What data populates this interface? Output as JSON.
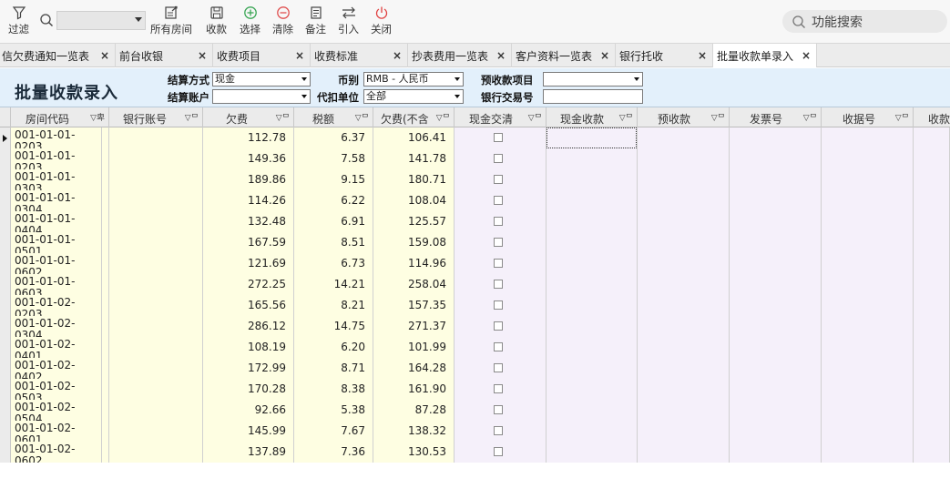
{
  "toolbar": {
    "filter_label": "过滤",
    "buttons": [
      {
        "label": "所有房间",
        "icon": "all-rooms-icon"
      },
      {
        "label": "收款",
        "icon": "save-icon"
      },
      {
        "label": "选择",
        "icon": "add-circle-icon"
      },
      {
        "label": "清除",
        "icon": "minus-circle-icon"
      },
      {
        "label": "备注",
        "icon": "note-icon"
      },
      {
        "label": "引入",
        "icon": "import-arrows-icon"
      },
      {
        "label": "关闭",
        "icon": "power-icon"
      }
    ],
    "function_search_placeholder": "功能搜索"
  },
  "tabs": [
    {
      "label": "信欠费通知一览表"
    },
    {
      "label": "前台收银"
    },
    {
      "label": "收费项目"
    },
    {
      "label": "收费标准"
    },
    {
      "label": "抄表费用一览表"
    },
    {
      "label": "客户资料一览表"
    },
    {
      "label": "银行托收"
    },
    {
      "label": "批量收款单录入",
      "active": true
    }
  ],
  "form": {
    "title": "批量收款录入",
    "settle_method_label": "结算方式",
    "settle_method_value": "现金",
    "settle_account_label": "结算账户",
    "settle_account_value": "",
    "currency_label": "币别",
    "currency_value": "RMB - 人民币",
    "agent_unit_label": "代扣单位",
    "agent_unit_value": "全部",
    "prepay_item_label": "预收款项目",
    "prepay_item_value": "",
    "bank_txn_label": "银行交易号",
    "bank_txn_value": ""
  },
  "grid": {
    "columns": [
      {
        "label": "房间代码",
        "filter": "▽卑"
      },
      {
        "label": "银行账号",
        "filter": "▽ᄆ"
      },
      {
        "label": "欠费",
        "filter": "▽ᄆ"
      },
      {
        "label": "税额",
        "filter": "▽ᄆ"
      },
      {
        "label": "欠费(不含",
        "filter": "▽ᄆ"
      },
      {
        "label": "现金交清",
        "filter": "▽ᄆ"
      },
      {
        "label": "现金收款",
        "filter": "▽ᄆ"
      },
      {
        "label": "预收款",
        "filter": "▽ᄆ"
      },
      {
        "label": "发票号",
        "filter": "▽ᄆ"
      },
      {
        "label": "收据号",
        "filter": "▽ᄆ"
      },
      {
        "label": "收款",
        "filter": ""
      }
    ],
    "rows": [
      {
        "room": "001-01-01-",
        "room2": "0203",
        "owed": "112.78",
        "tax": "6.37",
        "net": "106.41"
      },
      {
        "room": "001-01-01-",
        "room2": "0203",
        "owed": "149.36",
        "tax": "7.58",
        "net": "141.78"
      },
      {
        "room": "001-01-01-",
        "room2": "0303",
        "owed": "189.86",
        "tax": "9.15",
        "net": "180.71"
      },
      {
        "room": "001-01-01-",
        "room2": "0304",
        "owed": "114.26",
        "tax": "6.22",
        "net": "108.04"
      },
      {
        "room": "001-01-01-",
        "room2": "0404",
        "owed": "132.48",
        "tax": "6.91",
        "net": "125.57"
      },
      {
        "room": "001-01-01-",
        "room2": "0501",
        "owed": "167.59",
        "tax": "8.51",
        "net": "159.08"
      },
      {
        "room": "001-01-01-",
        "room2": "0602",
        "owed": "121.69",
        "tax": "6.73",
        "net": "114.96"
      },
      {
        "room": "001-01-01-",
        "room2": "0603",
        "owed": "272.25",
        "tax": "14.21",
        "net": "258.04"
      },
      {
        "room": "001-01-02-",
        "room2": "0203",
        "owed": "165.56",
        "tax": "8.21",
        "net": "157.35"
      },
      {
        "room": "001-01-02-",
        "room2": "0304",
        "owed": "286.12",
        "tax": "14.75",
        "net": "271.37"
      },
      {
        "room": "001-01-02-",
        "room2": "0401",
        "owed": "108.19",
        "tax": "6.20",
        "net": "101.99"
      },
      {
        "room": "001-01-02-",
        "room2": "0402",
        "owed": "172.99",
        "tax": "8.71",
        "net": "164.28"
      },
      {
        "room": "001-01-02-",
        "room2": "0503",
        "owed": "170.28",
        "tax": "8.38",
        "net": "161.90"
      },
      {
        "room": "001-01-02-",
        "room2": "0504",
        "owed": "92.66",
        "tax": "5.38",
        "net": "87.28"
      },
      {
        "room": "001-01-02-",
        "room2": "0601",
        "owed": "145.99",
        "tax": "7.67",
        "net": "138.32"
      },
      {
        "room": "001-01-02-",
        "room2": "0602",
        "owed": "137.89",
        "tax": "7.36",
        "net": "130.53"
      }
    ]
  },
  "colors": {
    "form_bg": "#e3f0fb",
    "readonly_cell": "#fefee2",
    "editable_cell": "#f5f0fa",
    "add_icon": "#3aa655",
    "remove_icon": "#e05050",
    "close_icon": "#e04040"
  }
}
